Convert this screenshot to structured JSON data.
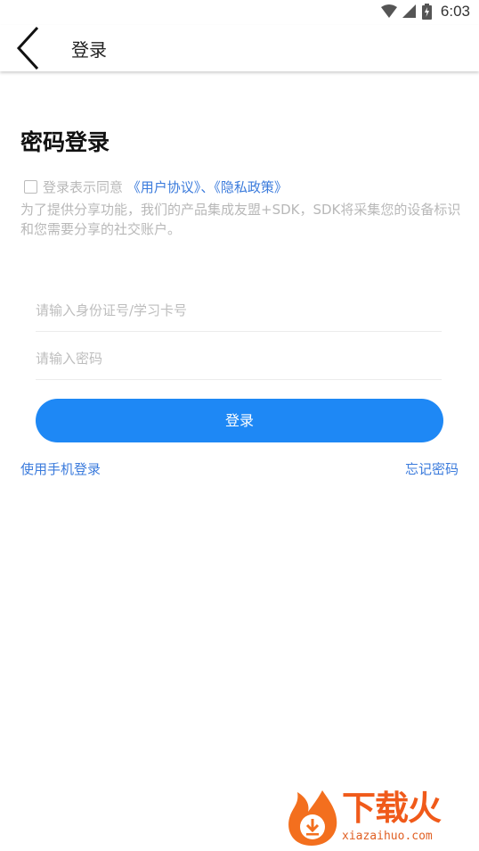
{
  "status_bar": {
    "time": "6:03"
  },
  "app_bar": {
    "title": "登录"
  },
  "heading": "密码登录",
  "agreement": {
    "prefix": "登录表示同意",
    "user_agreement": "《用户协议》",
    "separator": "、",
    "privacy_policy": "《隐私政策》",
    "notice": "为了提供分享功能，我们的产品集成友盟+SDK，SDK将采集您的设备标识和您需要分享的社交账户。"
  },
  "form": {
    "id_placeholder": "请输入身份证号/学习卡号",
    "password_placeholder": "请输入密码",
    "login_label": "登录"
  },
  "links": {
    "phone_login": "使用手机登录",
    "forgot_password": "忘记密码"
  },
  "watermark": {
    "brand": "下载火",
    "site": "xiazaihuo.com"
  },
  "colors": {
    "primary": "#1e88f5",
    "link": "#3b7bdc",
    "hint": "#b8b8b8",
    "watermark": "#f05a1a"
  }
}
